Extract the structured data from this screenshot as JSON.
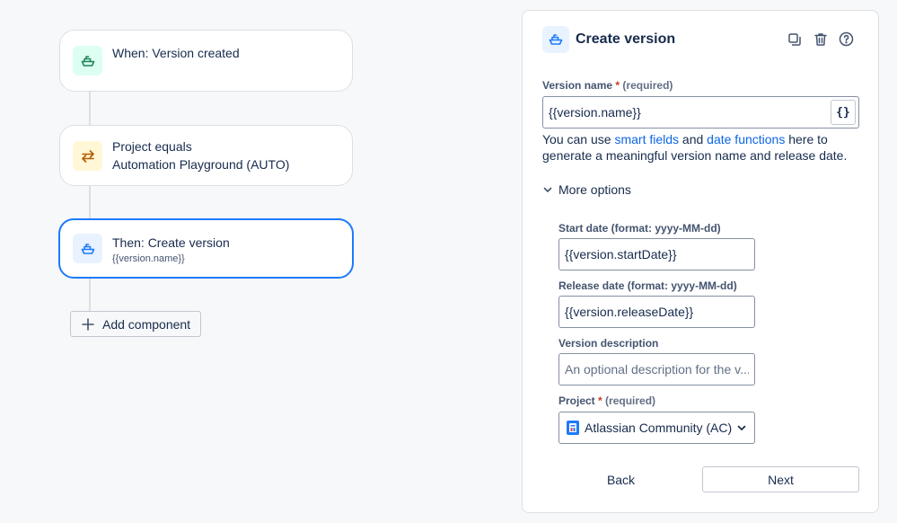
{
  "canvas": {
    "nodes": [
      {
        "title": "When: Version created",
        "subtitle": ""
      },
      {
        "title": "Project equals",
        "subtitle": "Automation Playground (AUTO)"
      },
      {
        "title": "Then: Create version",
        "subtitle": "{{version.name}}"
      }
    ],
    "add_component_label": "Add component"
  },
  "panel": {
    "title": "Create version",
    "icons": {
      "header": "ship-icon",
      "duplicate": "duplicate-icon",
      "delete": "trash-icon",
      "help": "help-icon"
    },
    "version_name": {
      "label": "Version name",
      "required_mark": "*",
      "required_text": "(required)",
      "value": "{{version.name}}",
      "braces_label": "{}"
    },
    "help_text": {
      "part1": "You can use ",
      "link1": "smart fields",
      "part2": " and ",
      "link2": "date functions",
      "part3": " here to generate a meaningful version name and release date."
    },
    "more_options_label": "More options",
    "start_date": {
      "label": "Start date (format: yyyy-MM-dd)",
      "value": "{{version.startDate}}"
    },
    "release_date": {
      "label": "Release date (format: yyyy-MM-dd)",
      "value": "{{version.releaseDate}}"
    },
    "description": {
      "label": "Version description",
      "placeholder": "An optional description for the v..."
    },
    "project": {
      "label": "Project",
      "required_mark": "*",
      "required_text": "(required)",
      "value": "Atlassian Community (AC)"
    },
    "buttons": {
      "back": "Back",
      "next": "Next"
    }
  },
  "colors": {
    "accent": "#1d7afc",
    "link": "#0c66e4",
    "required": "#c9372c"
  }
}
